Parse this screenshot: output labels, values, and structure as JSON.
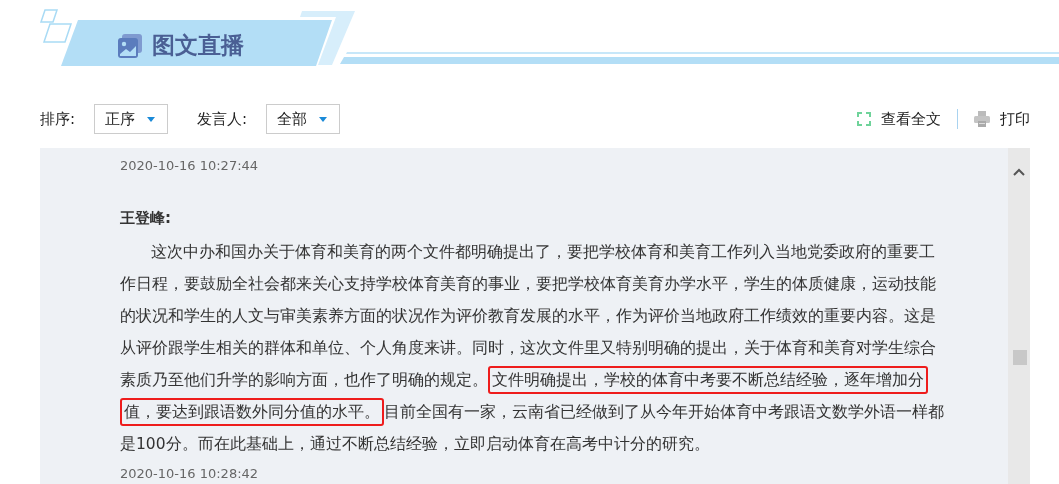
{
  "header": {
    "title": "图文直播"
  },
  "filters": [
    {
      "label": "排序:",
      "value": "正序"
    },
    {
      "label": "发言人:",
      "value": "全部"
    }
  ],
  "actions": [
    {
      "kind": "expand",
      "label": "查看全文"
    },
    {
      "kind": "print",
      "label": "打印"
    }
  ],
  "entries": [
    {
      "time": "2020-10-16 10:27:44",
      "speaker": "王登峰:",
      "paragraph": [
        {
          "text": "这次中办和国办关于体育和美育的两个文件都明确提出了，要把学校体育和美育工作列入当地党委政府的重要工作日程，要鼓励全社会都来关心支持学校体育美育的事业，要把学校体育美育办学水平，学生的体质健康，运动技能的状况和学生的人文与审美素养方面的状况作为评价教育发展的水平，作为评价当地政府工作绩效的重要内容。这是从评价跟学生相关的群体和单位、个人角度来讲。同时，这次文件里又特别明确的提出，关于体育和美育对学生综合素质乃至他们升学的影响方面，也作了明确的规定。",
          "highlighted": false
        },
        {
          "text": "文件明确提出，学校的体育中考要不断总结经验，逐年增加分值，要达到跟语数外同分值的水平。",
          "highlighted": true
        },
        {
          "text": "目前全国有一家，云南省已经做到了从今年开始体育中考跟语文数学外语一样都是100分。而在此基础上，通过不断总结经验，立即启动体育在高考中计分的研究。",
          "highlighted": false
        }
      ]
    },
    {
      "time": "2020-10-16 10:28:42"
    }
  ]
}
